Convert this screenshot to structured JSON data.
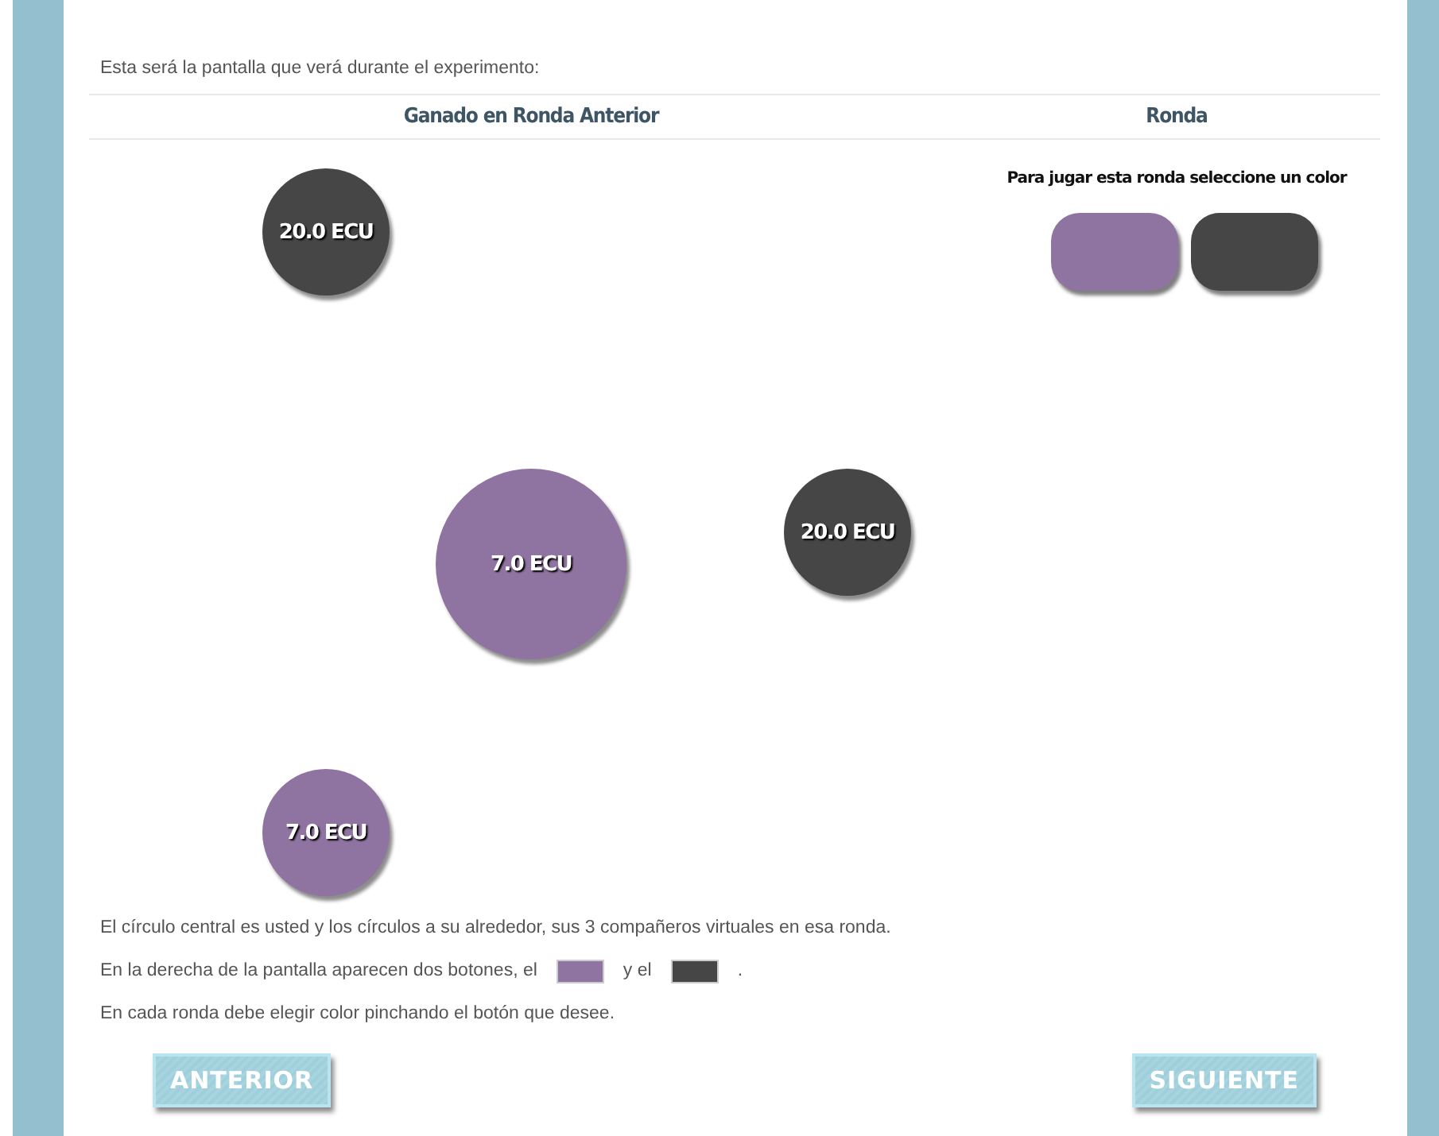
{
  "intro": "Esta será la pantalla que verá durante el experimento:",
  "columns": [
    "Ganado en Ronda Anterior",
    "Ronda"
  ],
  "players": [
    {
      "kind": "partner",
      "amount": "20.0 ECU",
      "color": "#464646"
    },
    {
      "kind": "self",
      "amount": "7.0 ECU",
      "color": "#8f73a0"
    },
    {
      "kind": "partner",
      "amount": "20.0 ECU",
      "color": "#464646"
    },
    {
      "kind": "partner",
      "amount": "7.0 ECU",
      "color": "#8f73a0"
    }
  ],
  "prompt": "Para jugar esta ronda seleccione un color",
  "color_buttons": [
    {
      "color": "#8f73a0"
    },
    {
      "color": "#464646"
    }
  ],
  "notes": [
    [
      {
        "kind": "text",
        "text": "El círculo central es usted y los círculos a su alrededor, sus 3 compañeros virtuales en esa ronda."
      }
    ],
    [
      {
        "kind": "text",
        "text": "En la derecha de la pantalla aparecen dos botones, el"
      },
      {
        "kind": "swatch",
        "color": "#8f73a0"
      },
      {
        "kind": "text",
        "text": "y el"
      },
      {
        "kind": "swatch",
        "color": "#464646"
      },
      {
        "kind": "text",
        "text": "."
      }
    ],
    [
      {
        "kind": "text",
        "text": "En cada ronda debe elegir color pinchando el botón que desee."
      }
    ]
  ],
  "nav": [
    "ANTERIOR",
    "SIGUIENTE"
  ]
}
